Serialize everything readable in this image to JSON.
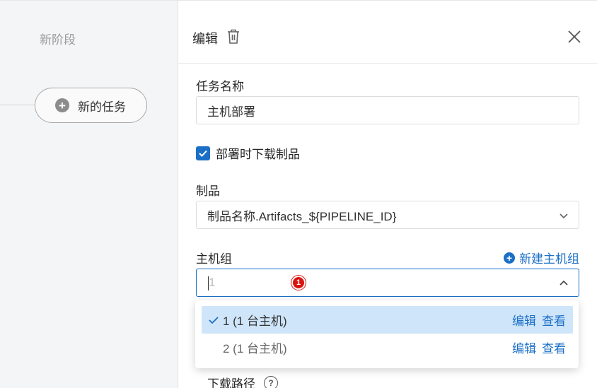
{
  "canvas": {
    "stage_title": "新阶段",
    "task_node_label": "新的任务",
    "task_node_icon": "plus-circle-icon"
  },
  "panel": {
    "title": "编辑",
    "trash_icon": "trash-icon",
    "close_icon": "close-icon",
    "task_name": {
      "label": "任务名称",
      "value": "主机部署"
    },
    "download_checkbox": {
      "label": "部署时下载制品",
      "checked": true
    },
    "artifact": {
      "label": "制品",
      "value": "制品名称.Artifacts_${PIPELINE_ID}"
    },
    "host_group": {
      "label": "主机组",
      "new_link": "新建主机组",
      "search_value": "1",
      "badge": "1",
      "options": [
        {
          "text": "1 (1 台主机)",
          "selected": true,
          "edit": "编辑",
          "view": "查看"
        },
        {
          "text": "2 (1 台主机)",
          "selected": false,
          "edit": "编辑",
          "view": "查看"
        }
      ]
    },
    "download_path": {
      "label": "下载路径",
      "help": "?"
    }
  },
  "colors": {
    "accent": "#1b6fc6",
    "selected_bg": "#cfe5fa",
    "badge": "#d9140f"
  }
}
